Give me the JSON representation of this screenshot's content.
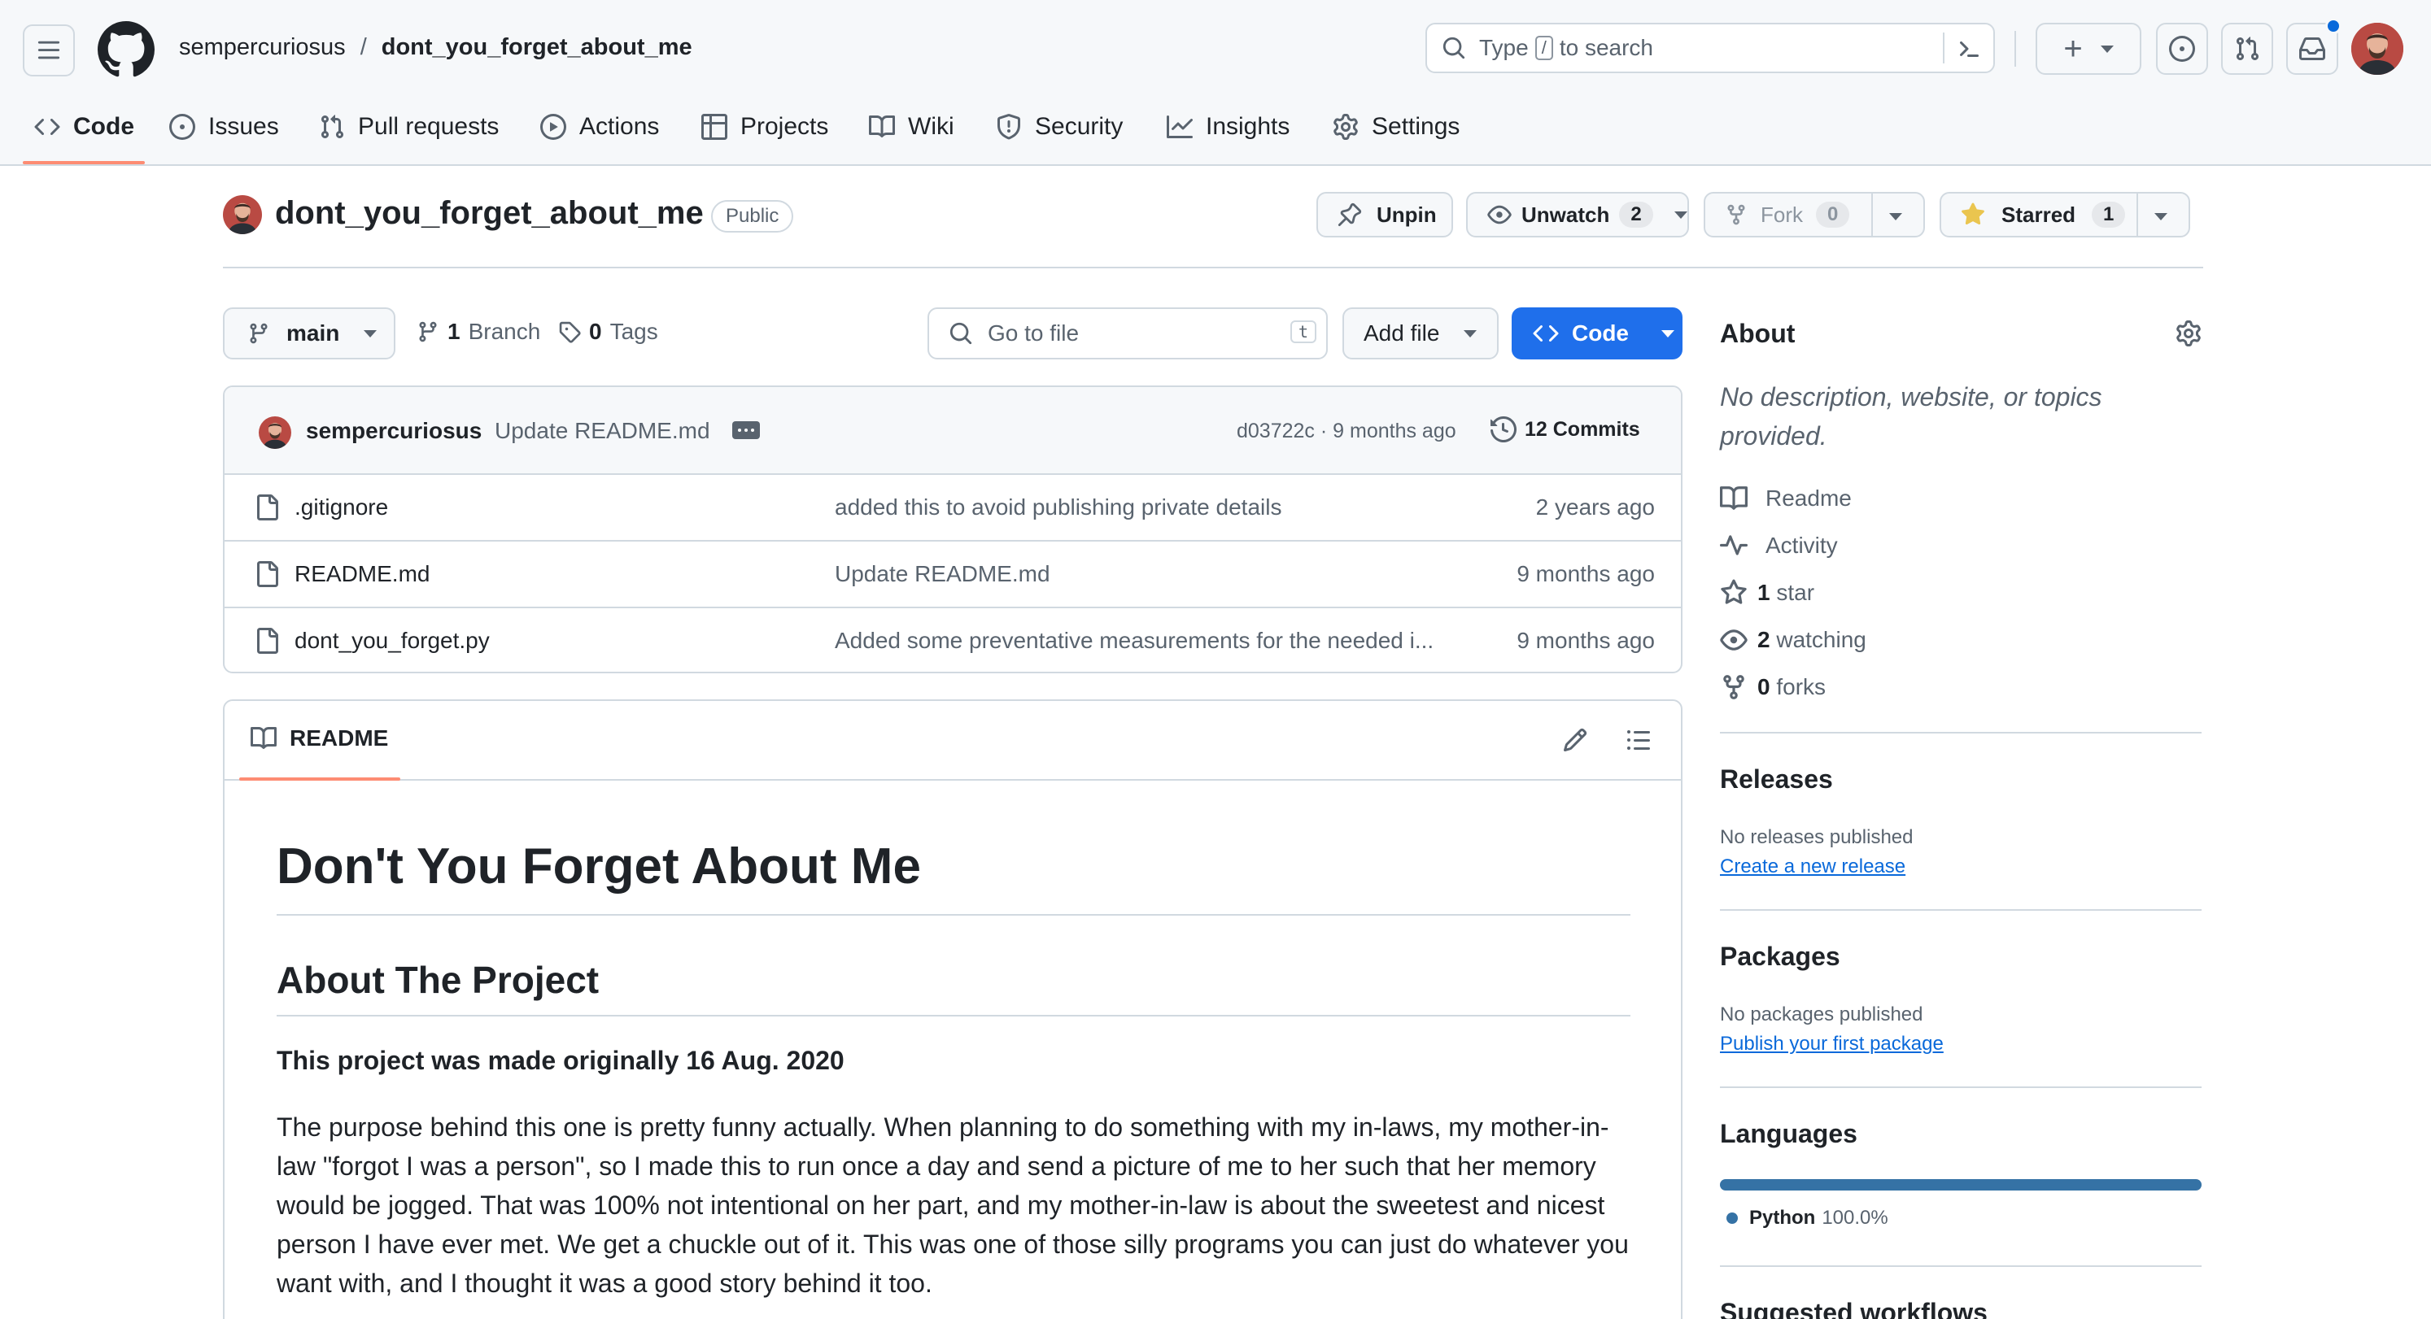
{
  "header": {
    "owner": "sempercuriosus",
    "slash": "/",
    "repo": "dont_you_forget_about_me",
    "search_prefix": "Type",
    "search_key": "/",
    "search_suffix": "to search",
    "plus": "+"
  },
  "tabs": [
    {
      "label": "Code"
    },
    {
      "label": "Issues"
    },
    {
      "label": "Pull requests"
    },
    {
      "label": "Actions"
    },
    {
      "label": "Projects"
    },
    {
      "label": "Wiki"
    },
    {
      "label": "Security"
    },
    {
      "label": "Insights"
    },
    {
      "label": "Settings"
    }
  ],
  "repo_head": {
    "title": "dont_you_forget_about_me",
    "visibility": "Public",
    "unpin": "Unpin",
    "unwatch": "Unwatch",
    "watch_count": "2",
    "fork": "Fork",
    "fork_count": "0",
    "starred": "Starred",
    "star_count": "1"
  },
  "toolbar": {
    "branch": "main",
    "branches_count": "1",
    "branches_label": "Branch",
    "tags_count": "0",
    "tags_label": "Tags",
    "goto_placeholder": "Go to file",
    "goto_key": "t",
    "add_file": "Add file",
    "code": "Code"
  },
  "commit": {
    "author": "sempercuriosus",
    "message": "Update README.md",
    "hash_time": "d03722c · 9 months ago",
    "commits_label": "12 Commits"
  },
  "files": [
    {
      "name": ".gitignore",
      "message": "added this to avoid publishing private details",
      "date": "2 years ago"
    },
    {
      "name": "README.md",
      "message": "Update README.md",
      "date": "9 months ago"
    },
    {
      "name": "dont_you_forget.py",
      "message": "Added some preventative measurements for the needed i...",
      "date": "9 months ago"
    }
  ],
  "readme": {
    "tab_label": "README",
    "h1": "Don't You Forget About Me",
    "h2": "About The Project",
    "bold_line": "This project was made originally 16 Aug. 2020",
    "paragraph": "The purpose behind this one is pretty funny actually. When planning to do something with my in-laws, my mother-in-law \"forgot I was a person\", so I made this to run once a day and send a picture of me to her such that her memory would be jogged. That was 100% not intentional on her part, and my mother-in-law is about the sweetest and nicest person I have ever met. We get a chuckle out of it. This was one of those silly programs you can just do whatever you want with, and I thought it was a good story behind it too."
  },
  "about": {
    "title": "About",
    "description": "No description, website, or topics provided.",
    "readme": "Readme",
    "activity": "Activity",
    "stars_count": "1",
    "stars_label": "star",
    "watching_count": "2",
    "watching_label": "watching",
    "forks_count": "0",
    "forks_label": "forks"
  },
  "releases": {
    "title": "Releases",
    "none": "No releases published",
    "link": "Create a new release"
  },
  "packages": {
    "title": "Packages",
    "none": "No packages published",
    "link": "Publish your first package"
  },
  "languages": {
    "title": "Languages",
    "items": [
      {
        "name": "Python",
        "percent": "100.0%",
        "value": 100,
        "color": "#3572A5"
      }
    ]
  },
  "suggested": {
    "title": "Suggested workflows"
  },
  "colors": {
    "accent": "#0969da",
    "code_button": "#1f6feb",
    "tab_underline": "#fd8c73",
    "star": "#eac54f",
    "notification_dot": "#0969da"
  }
}
